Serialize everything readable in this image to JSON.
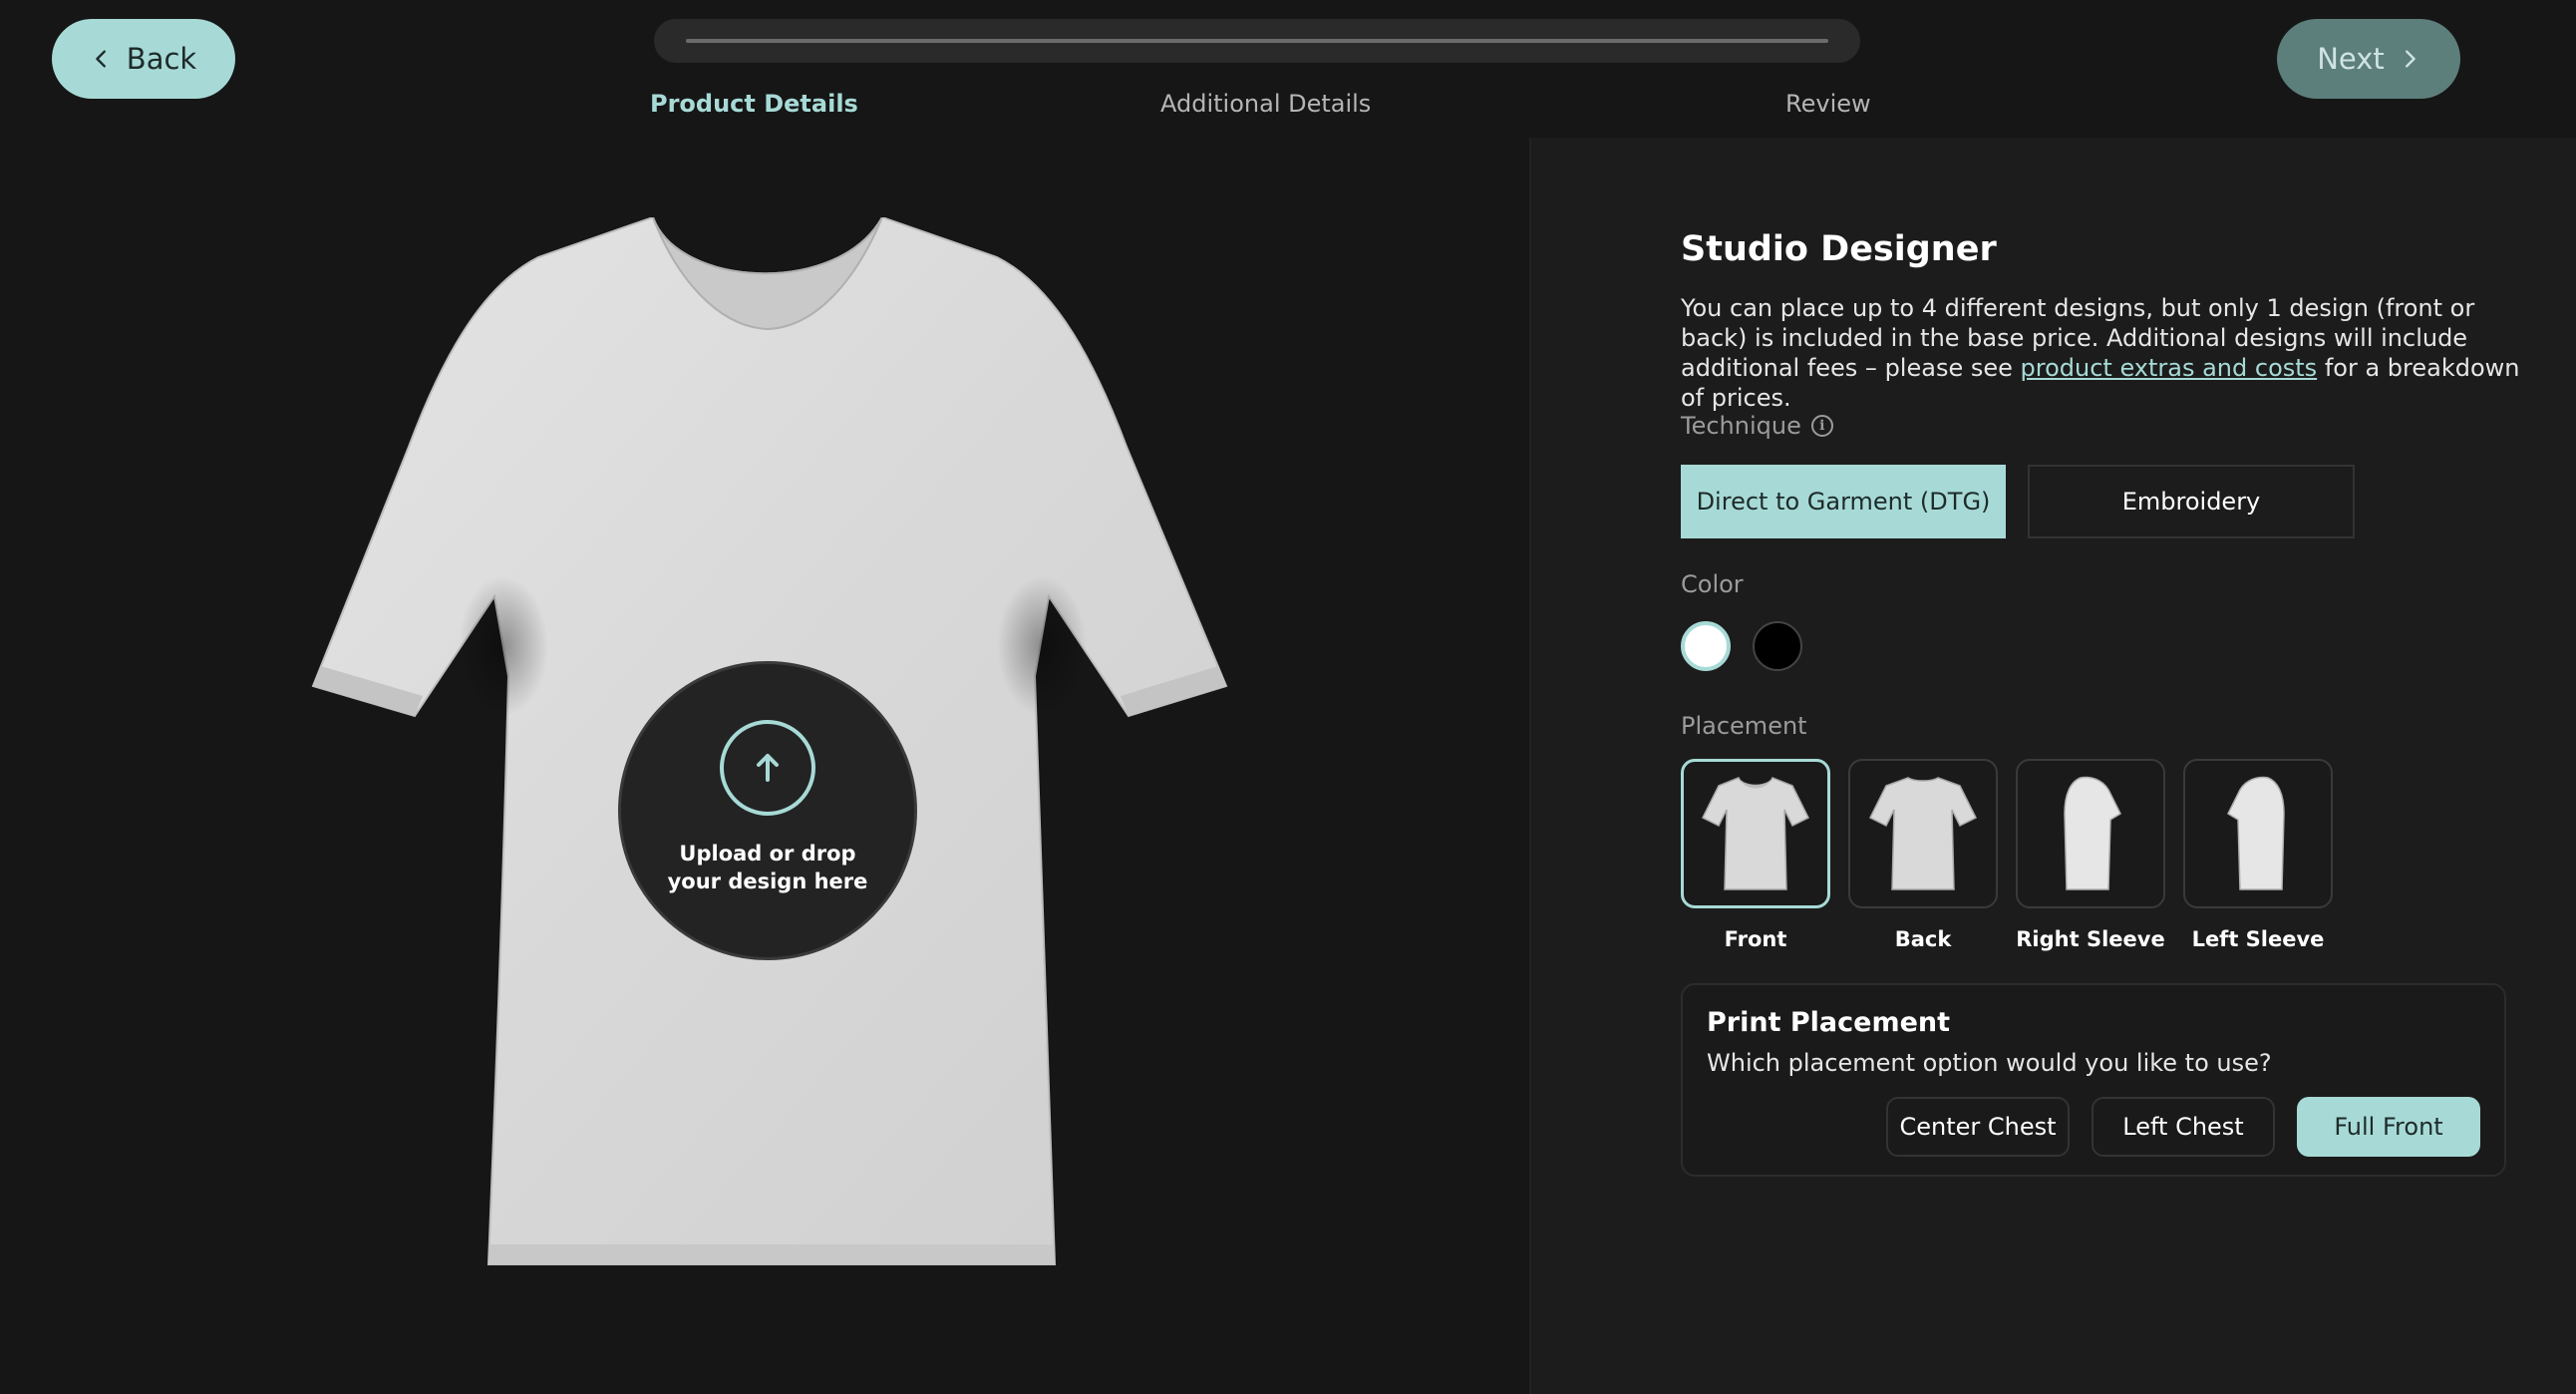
{
  "nav": {
    "back_label": "Back",
    "next_label": "Next",
    "progress_fraction": 0.0,
    "steps": [
      {
        "label": "Product Details",
        "active": true
      },
      {
        "label": "Additional Details",
        "active": false
      },
      {
        "label": "Review",
        "active": false
      }
    ]
  },
  "preview": {
    "upload_text_line1": "Upload or drop",
    "upload_text_line2": "your design here",
    "upload_icon": "arrow-up-icon"
  },
  "panel": {
    "title": "Studio Designer",
    "desc_before_link": "You can place up to 4 different designs, but only 1 design (front or back) is included in the base price. Additional designs will include additional fees – please see ",
    "desc_link": "product extras and costs",
    "desc_after_link": " for a breakdown of prices.",
    "technique_label": "Technique",
    "techniques": [
      {
        "label": "Direct to Garment (DTG)",
        "selected": true
      },
      {
        "label": "Embroidery",
        "selected": false
      }
    ],
    "color_label": "Color",
    "colors": [
      {
        "name": "white",
        "hex": "#ffffff",
        "selected": true
      },
      {
        "name": "black",
        "hex": "#000000",
        "selected": false
      }
    ],
    "placement_label": "Placement",
    "placements": [
      {
        "label": "Front",
        "selected": true
      },
      {
        "label": "Back",
        "selected": false
      },
      {
        "label": "Right Sleeve",
        "selected": false
      },
      {
        "label": "Left Sleeve",
        "selected": false
      }
    ],
    "print_placement": {
      "title": "Print Placement",
      "question": "Which placement option would you like to use?",
      "options": [
        {
          "label": "Center Chest",
          "selected": false
        },
        {
          "label": "Left Chest",
          "selected": false
        },
        {
          "label": "Full Front",
          "selected": true
        }
      ]
    }
  },
  "colors": {
    "accent": "#a7dad6",
    "background": "#161616",
    "panel": "#1c1c1c"
  }
}
